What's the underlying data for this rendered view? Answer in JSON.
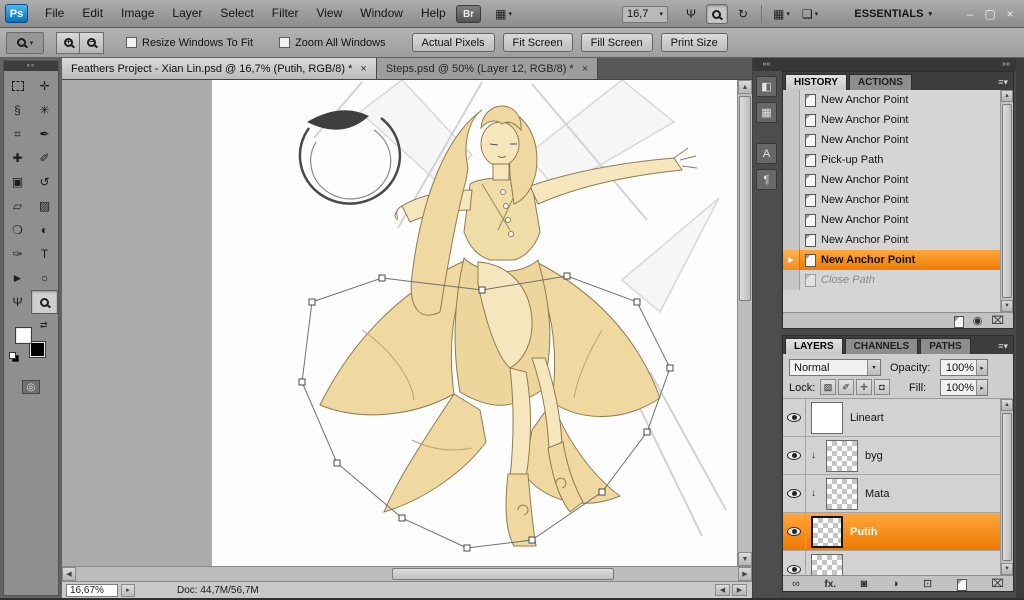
{
  "app_bar": {
    "logo": "Ps",
    "menus": [
      "File",
      "Edit",
      "Image",
      "Layer",
      "Select",
      "Filter",
      "View",
      "Window",
      "Help"
    ],
    "bridge": "Br",
    "zoom_value": "16,7",
    "workspace": "ESSENTIALS"
  },
  "options_bar": {
    "resize_windows": "Resize Windows To Fit",
    "zoom_all": "Zoom All Windows",
    "actual_pixels": "Actual Pixels",
    "fit_screen": "Fit Screen",
    "fill_screen": "Fill Screen",
    "print_size": "Print Size"
  },
  "document_tabs": {
    "tab1": "Feathers Project - Xian Lin.psd @ 16,7% (Putih, RGB/8) *",
    "tab2": "Steps.psd @ 50% (Layer 12, RGB/8) *"
  },
  "history": {
    "tab_history": "HISTORY",
    "tab_actions": "ACTIONS",
    "items": [
      "New Anchor Point",
      "New Anchor Point",
      "New Anchor Point",
      "Pick-up Path",
      "New Anchor Point",
      "New Anchor Point",
      "New Anchor Point",
      "New Anchor Point",
      "New Anchor Point",
      "Close Path"
    ]
  },
  "layers": {
    "tab_layers": "LAYERS",
    "tab_channels": "CHANNELS",
    "tab_paths": "PATHS",
    "blend_mode": "Normal",
    "opacity_label": "Opacity:",
    "opacity_value": "100%",
    "lock_label": "Lock:",
    "fill_label": "Fill:",
    "fill_value": "100%",
    "names": [
      "Lineart",
      "byg",
      "Mata",
      "Putih"
    ],
    "fx_label": "fx."
  },
  "status_bar": {
    "zoom": "16,67%",
    "doc": "Doc: 44,7M/56,7M"
  },
  "colors": {
    "selection_orange": "#F68B1F",
    "selection_orange_dark": "#EE7500",
    "panel_gray": "#D4D4D4",
    "app_gray": "#9C9C9C"
  },
  "icons": {
    "dropdown": "▾",
    "panel_menu": "≡▾",
    "collapse_left": "««",
    "collapse_right": "»»",
    "scroll_up": "▲",
    "scroll_down": "▼",
    "scroll_left": "◀",
    "scroll_right": "▶",
    "flyout": "▸",
    "minimize": "–",
    "restore": "▢",
    "close": "×",
    "tab_close": "×",
    "move": "✛",
    "lasso": "§",
    "quick_select": "✳",
    "crop": "⌗",
    "eyedropper": "✒",
    "healing": "✚",
    "brush": "✐",
    "clone_stamp": "▣",
    "history_brush": "↺",
    "eraser": "▱",
    "gradient": "▨",
    "blur": "❍",
    "dodge": "◐",
    "pen": "✑",
    "type": "T",
    "path_select": "►",
    "shape": "○",
    "hand": "Ψ",
    "swap": "⇄",
    "rotate_view": "↻",
    "arrange_docs": "▦",
    "screen_mode": "❏",
    "extras": "▦",
    "panel_color": "◧",
    "panel_swatches": "▦",
    "panel_character": "A",
    "panel_paragraph": "¶",
    "lock_transparent": "▨",
    "lock_image": "✐",
    "lock_position": "✛",
    "lock_all": "◘",
    "link": "∞",
    "mask": "◙",
    "adjustment": "◑",
    "group": "⊡",
    "delete": "⌧",
    "snapshot": "◉",
    "new_doc": "▤",
    "clip_arrow": "↓",
    "plus": "+",
    "minus": "−",
    "history_pointer": "▶",
    "quickmask": "◎"
  }
}
